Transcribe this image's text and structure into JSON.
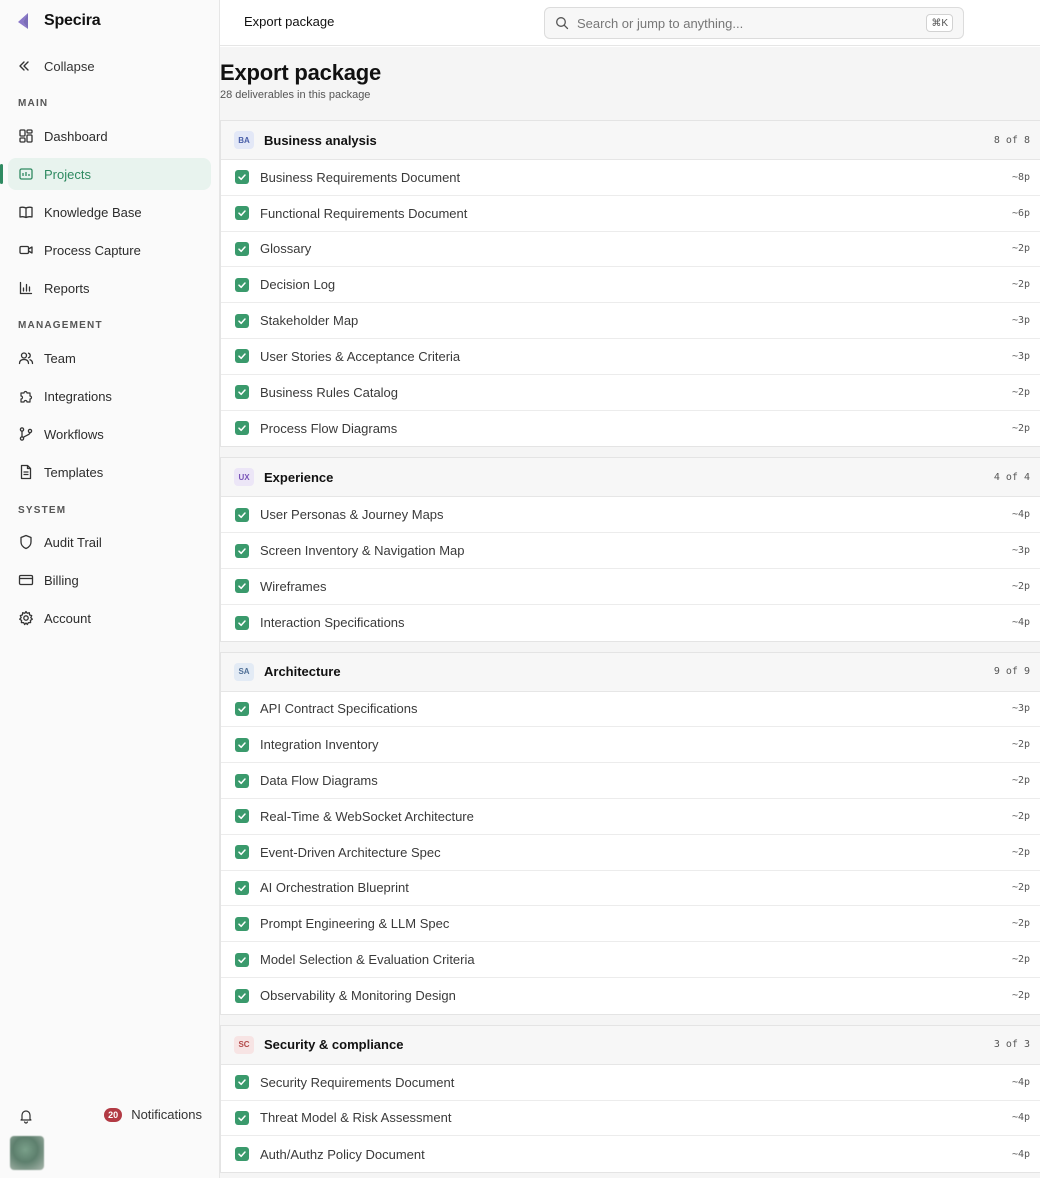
{
  "app": {
    "name": "Specira"
  },
  "sidebar": {
    "collapse_label": "Collapse",
    "sections": {
      "main": "MAIN",
      "management": "MANAGEMENT",
      "system": "SYSTEM"
    },
    "items": [
      {
        "label": "Dashboard",
        "icon": "grid-icon"
      },
      {
        "label": "Projects",
        "icon": "projects-icon",
        "active": true
      },
      {
        "label": "Knowledge Base",
        "icon": "book-icon"
      },
      {
        "label": "Process Capture",
        "icon": "video-icon"
      },
      {
        "label": "Reports",
        "icon": "bar-chart-icon"
      },
      {
        "label": "Team",
        "icon": "users-icon"
      },
      {
        "label": "Integrations",
        "icon": "puzzle-icon"
      },
      {
        "label": "Workflows",
        "icon": "git-branch-icon"
      },
      {
        "label": "Templates",
        "icon": "file-text-icon"
      },
      {
        "label": "Audit Trail",
        "icon": "shield-icon"
      },
      {
        "label": "Billing",
        "icon": "credit-card-icon"
      },
      {
        "label": "Account",
        "icon": "gear-icon"
      }
    ],
    "notifications": {
      "count": "20",
      "label": "Notifications"
    }
  },
  "topbar": {
    "title": "Export package",
    "search_placeholder": "Search or jump to anything...",
    "shortcut": "⌘K"
  },
  "page": {
    "title": "Export package",
    "subtitle": "28 deliverables in this package"
  },
  "colors": {
    "accent": "#2f8a61",
    "check": "#3a9a6c",
    "notification_badge": "#b23a44"
  },
  "groups": [
    {
      "badge": "BA",
      "badge_bg": "#e3e8f7",
      "badge_fg": "#4a5fa8",
      "name": "Business analysis",
      "count": "8 of 8",
      "items": [
        {
          "label": "Business Requirements Document",
          "pages": "~8p"
        },
        {
          "label": "Functional Requirements Document",
          "pages": "~6p"
        },
        {
          "label": "Glossary",
          "pages": "~2p"
        },
        {
          "label": "Decision Log",
          "pages": "~2p"
        },
        {
          "label": "Stakeholder Map",
          "pages": "~3p"
        },
        {
          "label": "User Stories & Acceptance Criteria",
          "pages": "~3p"
        },
        {
          "label": "Business Rules Catalog",
          "pages": "~2p"
        },
        {
          "label": "Process Flow Diagrams",
          "pages": "~2p"
        }
      ]
    },
    {
      "badge": "UX",
      "badge_bg": "#ece6f7",
      "badge_fg": "#7a55b8",
      "name": "Experience",
      "count": "4 of 4",
      "items": [
        {
          "label": "User Personas & Journey Maps",
          "pages": "~4p"
        },
        {
          "label": "Screen Inventory & Navigation Map",
          "pages": "~3p"
        },
        {
          "label": "Wireframes",
          "pages": "~2p"
        },
        {
          "label": "Interaction Specifications",
          "pages": "~4p"
        }
      ]
    },
    {
      "badge": "SA",
      "badge_bg": "#e3ebf5",
      "badge_fg": "#4f6f96",
      "name": "Architecture",
      "count": "9 of 9",
      "items": [
        {
          "label": "API Contract Specifications",
          "pages": "~3p"
        },
        {
          "label": "Integration Inventory",
          "pages": "~2p"
        },
        {
          "label": "Data Flow Diagrams",
          "pages": "~2p"
        },
        {
          "label": "Real-Time & WebSocket Architecture",
          "pages": "~2p"
        },
        {
          "label": "Event-Driven Architecture Spec",
          "pages": "~2p"
        },
        {
          "label": "AI Orchestration Blueprint",
          "pages": "~2p"
        },
        {
          "label": "Prompt Engineering & LLM Spec",
          "pages": "~2p"
        },
        {
          "label": "Model Selection & Evaluation Criteria",
          "pages": "~2p"
        },
        {
          "label": "Observability & Monitoring Design",
          "pages": "~2p"
        }
      ]
    },
    {
      "badge": "SC",
      "badge_bg": "#f7e4e4",
      "badge_fg": "#b34a4a",
      "name": "Security & compliance",
      "count": "3 of 3",
      "items": [
        {
          "label": "Security Requirements Document",
          "pages": "~4p"
        },
        {
          "label": "Threat Model & Risk Assessment",
          "pages": "~4p"
        },
        {
          "label": "Auth/Authz Policy Document",
          "pages": "~4p"
        }
      ]
    }
  ]
}
